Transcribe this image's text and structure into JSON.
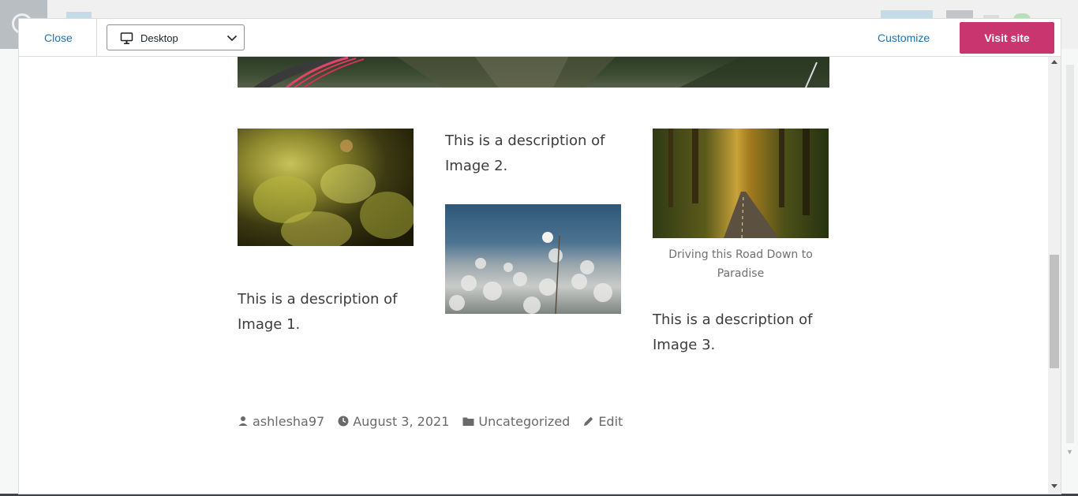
{
  "header": {
    "close_label": "Close",
    "device_label": "Desktop",
    "customize_label": "Customize",
    "visit_label": "Visit site"
  },
  "gallery": {
    "desc1": "This is a description of Image 1.",
    "desc2": "This is a description of Image 2.",
    "desc3": "This is a description of Image 3.",
    "caption3": "Driving this Road Down to Paradise"
  },
  "post_meta": {
    "author": "ashlesha97",
    "date": "August 3, 2021",
    "category": "Uncategorized",
    "edit": "Edit"
  },
  "colors": {
    "accent": "#c9356e",
    "link": "#2271b1"
  }
}
